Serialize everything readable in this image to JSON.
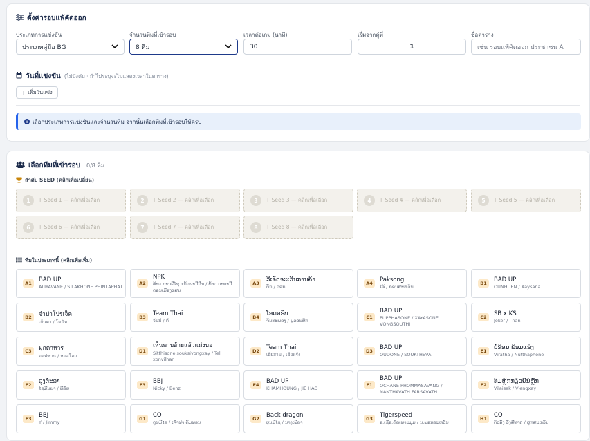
{
  "settings": {
    "title": "ตั้งค่ารอบแพ้คัดออก",
    "fields": [
      {
        "label": "ประเภทการแข่งขัน",
        "value": "ประเภทคู่มือ BG"
      },
      {
        "label": "จำนวนทีมที่เข้ารอบ",
        "value": "8 ทีม"
      },
      {
        "label": "เวลาต่อเกม (นาที)",
        "value": "30"
      },
      {
        "label": "เริ่มจากคู่ที่",
        "value": "1"
      },
      {
        "label": "ชื่อตาราง",
        "placeholder": "เช่น รอบแพ้คัดออก ประชาชน A"
      }
    ],
    "schedule": {
      "title": "วันที่แข่งขัน",
      "hint": "(ไม่บังคับ · ถ้าไม่ระบุจะไม่แสดงเวลาในตาราง)",
      "add_button": "เพิ่มวันแข่ง"
    },
    "alert": "เลือกประเภทการแข่งขันและจำนวนทีม จากนั้นเลือกทีมที่เข้ารอบให้ครบ"
  },
  "teams_section": {
    "title": "เลือกทีมที่เข้ารอบ",
    "count": "0/8 ทีม",
    "seed_title": "ลำดับ SEED (คลิกเพื่อเปลี่ยน)",
    "seeds": [
      {
        "num": "1",
        "label": "+ Seed 1 — คลิกเพื่อเลือก"
      },
      {
        "num": "2",
        "label": "+ Seed 2 — คลิกเพื่อเลือก"
      },
      {
        "num": "3",
        "label": "+ Seed 3 — คลิกเพื่อเลือก"
      },
      {
        "num": "4",
        "label": "+ Seed 4 — คลิกเพื่อเลือก"
      },
      {
        "num": "5",
        "label": "+ Seed 5 — คลิกเพื่อเลือก"
      },
      {
        "num": "6",
        "label": "+ Seed 6 — คลิกเพื่อเลือก"
      },
      {
        "num": "7",
        "label": "+ Seed 7 — คลิกเพื่อเลือก"
      },
      {
        "num": "8",
        "label": "+ Seed 8 — คลิกเพื่อเลือก"
      }
    ],
    "list_title": "ทีมในประเภทนี้ (คลิกเพื่อเพิ่ม)",
    "teams": [
      {
        "code": "A1",
        "name": "BAD UP",
        "players": "ALIYAVANE / SILAKHONE PHINLAPHAT"
      },
      {
        "code": "A2",
        "name": "NPK",
        "players": "ທ້າວ ຄານພີໂຊ ແກ້ວພາມີດີນ / ທ້າວ ບາຍາມີ ຄອນເມືອງແສນ"
      },
      {
        "code": "A3",
        "name": "ວີເຈັດຈະເວີນການຄ້າ",
        "players": "ຕຶກ / ວອກ"
      },
      {
        "code": "A4",
        "name": "Paksong",
        "players": "ໂຈ້ / ຄອນສະຫວັນ"
      },
      {
        "code": "B1",
        "name": "BAD UP",
        "players": "OUNHUEN / Xaysana"
      },
      {
        "code": "B2",
        "name": "จำปาโปรเจ็ค",
        "players": "เก้นตา / โตนัท"
      },
      {
        "code": "B3",
        "name": "Team Thai",
        "players": "จัมม์ / ตี"
      },
      {
        "code": "B4",
        "name": "ໂອດອຣັບ",
        "players": "ຈັນທະພອງ / ພູວອນສັກ"
      },
      {
        "code": "C1",
        "name": "BAD UP",
        "players": "PUPPHASONE / XAYASONE VONGSOUTHI"
      },
      {
        "code": "C2",
        "name": "SB x KS",
        "players": "Joker / I nan"
      },
      {
        "code": "C3",
        "name": "มุกดาหาร",
        "players": "ออฟซาน / หมอโอม"
      },
      {
        "code": "D1",
        "name": "เห็นพาบอ้ายแล้วแม่งบอ",
        "players": "Sitthisone souksivongxay / Tel xonvilhan"
      },
      {
        "code": "D2",
        "name": "Team Thai",
        "players": "เฮียสาม / เฮียหรั่ง"
      },
      {
        "code": "D3",
        "name": "BAD UP",
        "players": "OUDONE / SOUKTHEVA"
      },
      {
        "code": "E1",
        "name": "ບໍ່ຊ້ອມ ພ້ອມແຂ່ງ",
        "players": "Viratha / Nutthaphone"
      },
      {
        "code": "E2",
        "name": "ລຸງຕ໋ະລາ",
        "players": "ໄຊມີນຍາ / ພີສັຍ"
      },
      {
        "code": "E3",
        "name": "BBJ",
        "players": "Nicky / Benz"
      },
      {
        "code": "E4",
        "name": "BAD UP",
        "players": "KHAMHOUNG / JIE HAO"
      },
      {
        "code": "F1",
        "name": "BAD UP",
        "players": "OCHANE PHOMMASAVANG / NANTHAVATH FARSAVATH"
      },
      {
        "code": "F2",
        "name": "ທີມຫຼົກກຽວຢີ່ນໍ່ຫຼັກ",
        "players": "Vilaisak / Viengxay"
      },
      {
        "code": "F3",
        "name": "BBJ",
        "players": "Y / Jimmy"
      },
      {
        "code": "G1",
        "name": "CQ",
        "players": "ຄຸນມີໄຊ / ເຈົ້າຟ້າ ຄົມພອນ"
      },
      {
        "code": "G2",
        "name": "Back dragon",
        "players": "ບຸນມີໄຊ / ນາງເພີດາ"
      },
      {
        "code": "G3",
        "name": "Tigerspeed",
        "players": "ອ.ເຊື່ອ.ຄັດເພາະມຸມ / ນ.ພອນສະຫວັນ"
      },
      {
        "code": "H1",
        "name": "CQ",
        "players": "ຕິວອັງ ວັງສີທາດ / ສຸກສະຫວັນ"
      }
    ]
  }
}
